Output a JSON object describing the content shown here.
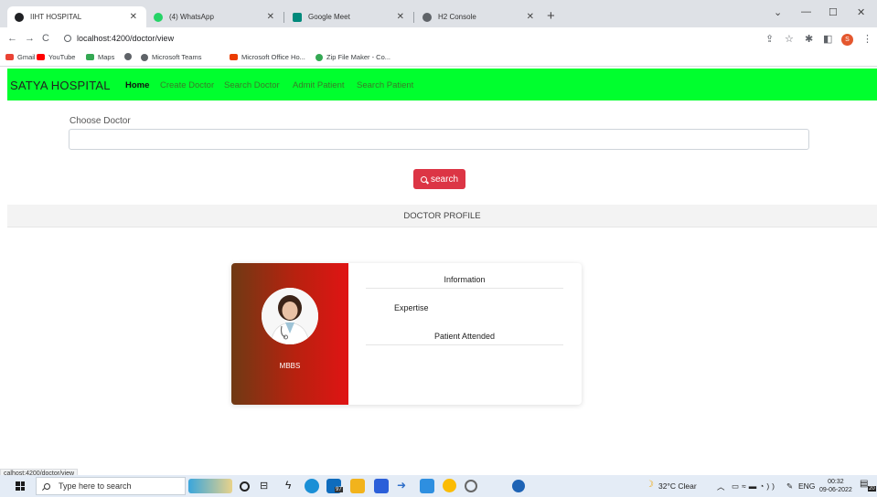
{
  "browser": {
    "tabs": [
      {
        "title": "IIHT HOSPITAL",
        "active": true,
        "color": "#202124"
      },
      {
        "title": "(4) WhatsApp",
        "active": false,
        "color": "#25d366"
      },
      {
        "title": "Google Meet",
        "active": false,
        "color": "#00897b"
      },
      {
        "title": "H2 Console",
        "active": false,
        "color": "#5f6368"
      }
    ],
    "new_tab": "+",
    "url": "localhost:4200/doctor/view",
    "profile_initial": "S",
    "bookmarks": [
      {
        "label": "Gmail",
        "color": "#ea4335"
      },
      {
        "label": "YouTube",
        "color": "#ff0000"
      },
      {
        "label": "Maps",
        "color": "#34a853"
      },
      {
        "label": "",
        "color": "#5f6368"
      },
      {
        "label": "Microsoft Teams",
        "color": "#5f6368"
      },
      {
        "label": "Microsoft Office Ho...",
        "color": "#eb3c00"
      },
      {
        "label": "Zip File Maker - Co...",
        "color": "#34a853"
      }
    ]
  },
  "nav": {
    "brand": "SATYA HOSPITAL",
    "links": [
      "Home",
      "Create Doctor",
      "Search Doctor",
      "Admit Patient",
      "Search Patient"
    ]
  },
  "form": {
    "label": "Choose Doctor",
    "value": "",
    "button": "search"
  },
  "profile": {
    "header": "DOCTOR PROFILE",
    "degree": "MBBS",
    "info_title": "Information",
    "expertise": "Expertise",
    "patients": "Patient Attended"
  },
  "status_url": "calhost:4200/doctor/view",
  "taskbar": {
    "search_placeholder": "Type here to search",
    "weather": "32°C  Clear",
    "lang": "ENG",
    "time": "00:32",
    "date": "09-06-2022",
    "notif_count": "20",
    "badge": "97"
  },
  "colors": {
    "navbar": "#00ff2e",
    "search_button": "#dc3545",
    "card_gradient_start": "#6f3a14",
    "card_gradient_end": "#e01414"
  }
}
